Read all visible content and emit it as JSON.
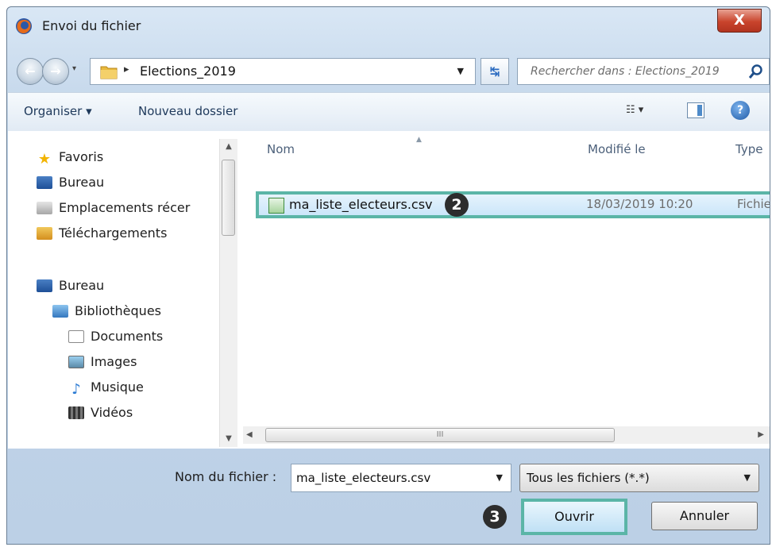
{
  "window": {
    "title": "Envoi du fichier",
    "close_label": "X"
  },
  "navbar": {
    "path_separator": "▸",
    "path_folder": "Elections_2019",
    "search_placeholder": "Rechercher dans : Elections_2019"
  },
  "toolbar": {
    "organiser_label": "Organiser ▾",
    "new_folder_label": "Nouveau dossier",
    "help_label": "?"
  },
  "sidebar": {
    "items": [
      {
        "label": "Favoris",
        "icon": "star-icon"
      },
      {
        "label": "Bureau",
        "icon": "desktop-icon"
      },
      {
        "label": "Emplacements récer",
        "icon": "recent-places-icon"
      },
      {
        "label": "Téléchargements",
        "icon": "downloads-icon"
      },
      {
        "label": "Bureau",
        "icon": "desktop-icon"
      },
      {
        "label": "Bibliothèques",
        "icon": "libraries-icon"
      },
      {
        "label": "Documents",
        "icon": "documents-icon"
      },
      {
        "label": "Images",
        "icon": "images-icon"
      },
      {
        "label": "Musique",
        "icon": "music-icon"
      },
      {
        "label": "Vidéos",
        "icon": "videos-icon"
      }
    ]
  },
  "files": {
    "columns": {
      "name": "Nom",
      "modified": "Modifié le",
      "type": "Type"
    },
    "rows": [
      {
        "name": "ma_liste_electeurs.csv",
        "modified": "18/03/2019 10:20",
        "type": "Fichier"
      }
    ]
  },
  "badges": {
    "file": "2",
    "open": "3"
  },
  "bottom": {
    "filename_label": "Nom du fichier :",
    "filename_value": "ma_liste_electeurs.csv",
    "filter_value": "Tous les fichiers (*.*)",
    "open_label": "Ouvrir",
    "cancel_label": "Annuler"
  },
  "colors": {
    "highlight_border": "#5bb5a7",
    "badge_bg": "#2d2d2d"
  }
}
